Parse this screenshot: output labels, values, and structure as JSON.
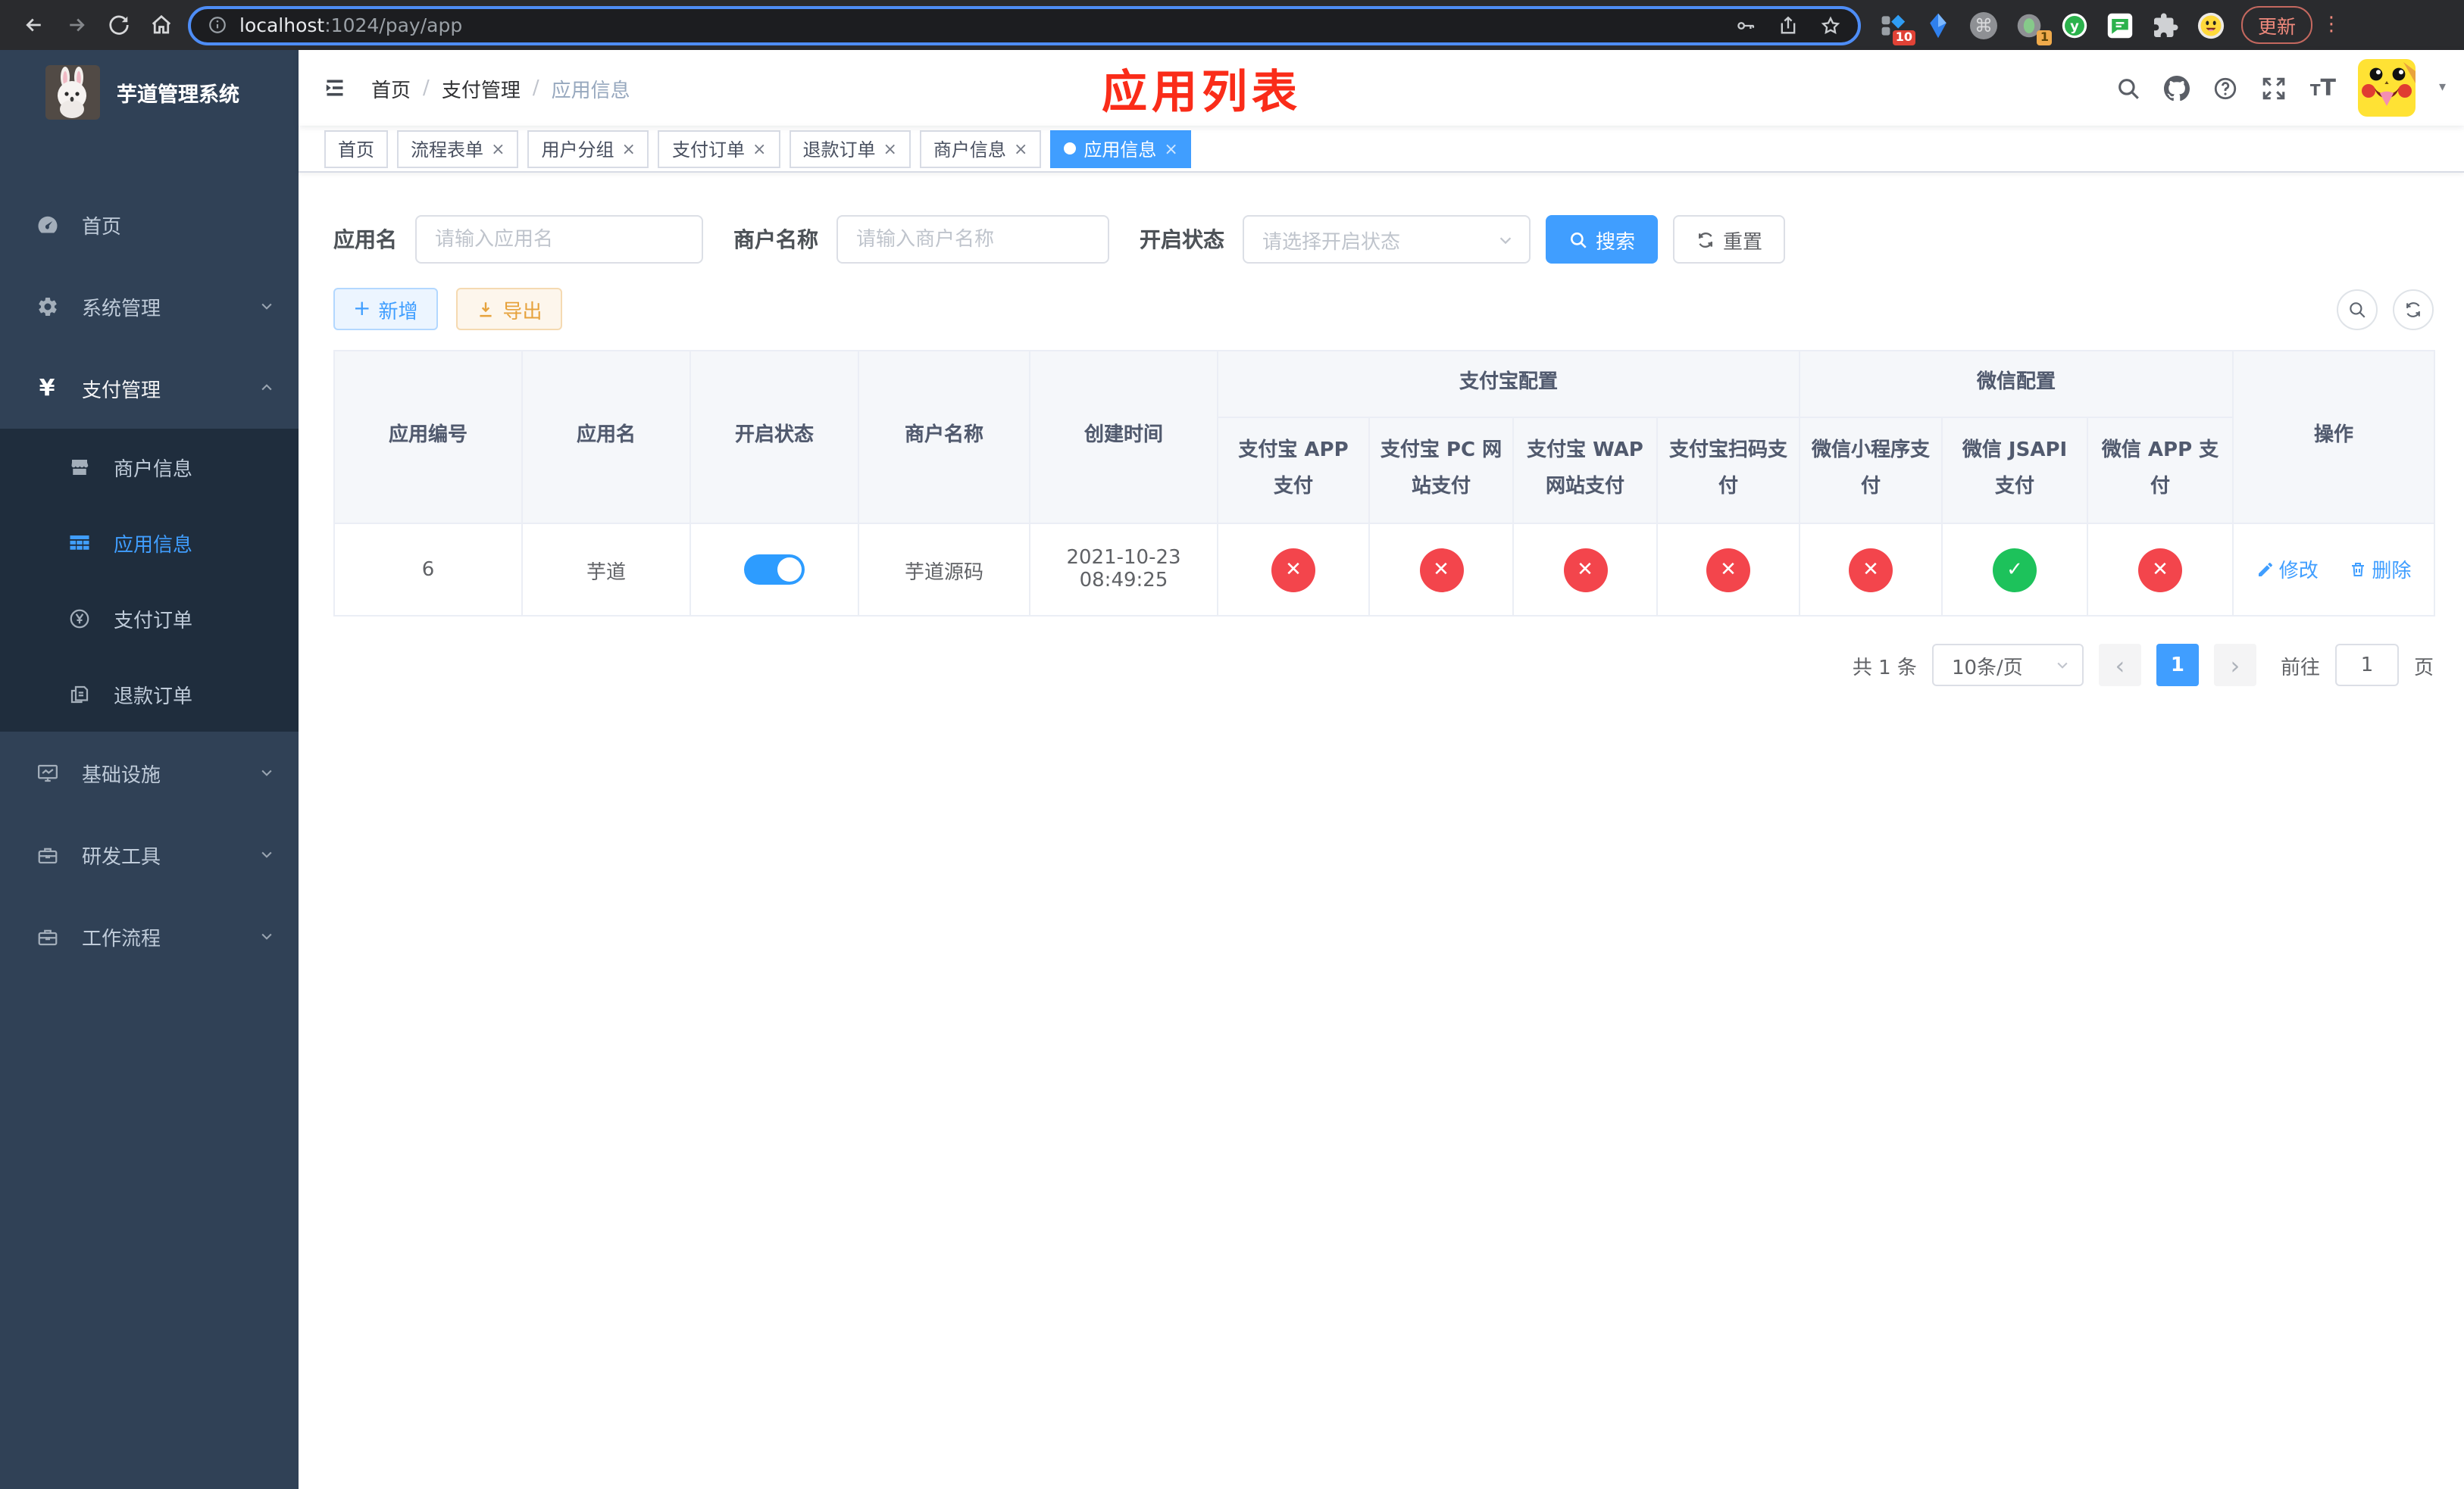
{
  "browser": {
    "url_host": "localhost",
    "url_path": ":1024/pay/app",
    "update_button": "更新",
    "extensions": {
      "badge_blue_diamond": "10",
      "badge_green_dot": "1"
    }
  },
  "sidebar": {
    "title": "芋道管理系统",
    "items": [
      {
        "label": "首页"
      },
      {
        "label": "系统管理"
      },
      {
        "label": "支付管理",
        "children": [
          {
            "label": "商户信息"
          },
          {
            "label": "应用信息"
          },
          {
            "label": "支付订单"
          },
          {
            "label": "退款订单"
          }
        ]
      },
      {
        "label": "基础设施"
      },
      {
        "label": "研发工具"
      },
      {
        "label": "工作流程"
      }
    ]
  },
  "navbar": {
    "breadcrumb": [
      "首页",
      "支付管理",
      "应用信息"
    ],
    "annotation": "应用列表"
  },
  "tabs": [
    {
      "label": "首页"
    },
    {
      "label": "流程表单"
    },
    {
      "label": "用户分组"
    },
    {
      "label": "支付订单"
    },
    {
      "label": "退款订单"
    },
    {
      "label": "商户信息"
    },
    {
      "label": "应用信息"
    }
  ],
  "filters": {
    "app_name_label": "应用名",
    "app_name_placeholder": "请输入应用名",
    "merchant_label": "商户名称",
    "merchant_placeholder": "请输入商户名称",
    "status_label": "开启状态",
    "status_placeholder": "请选择开启状态",
    "search_button": "搜索",
    "reset_button": "重置"
  },
  "toolbar": {
    "add_button": "新增",
    "export_button": "导出"
  },
  "table": {
    "main_columns": [
      "应用编号",
      "应用名",
      "开启状态",
      "商户名称",
      "创建时间"
    ],
    "group_alipay": {
      "label": "支付宝配置",
      "columns": [
        "支付宝 APP 支付",
        "支付宝 PC 网站支付",
        "支付宝 WAP 网站支付",
        "支付宝扫码支付"
      ]
    },
    "group_wechat": {
      "label": "微信配置",
      "columns": [
        "微信小程序支付",
        "微信 JSAPI 支付",
        "微信 APP 支付"
      ]
    },
    "actions_column": "操作",
    "rows": [
      {
        "app_id": "6",
        "app_name": "芋道",
        "enabled": "on",
        "merchant_name": "芋道源码",
        "create_time": "2021-10-23 08:49:25",
        "statuses": [
          "cross",
          "cross",
          "cross",
          "cross",
          "cross",
          "check",
          "cross"
        ],
        "edit_label": "修改",
        "delete_label": "删除"
      }
    ]
  },
  "pagination": {
    "total_text": "共 1 条",
    "page_size": "10条/页",
    "current_page": "1",
    "goto_label": "前往",
    "goto_value": "1",
    "page_unit": "页"
  },
  "colors": {
    "primary": "#409eff",
    "success": "#1dc25b",
    "danger": "#f3454c",
    "warning": "#e6a23c",
    "annotation_red": "#fa2c19",
    "sidebar_bg": "#304156",
    "submenu_bg": "#1f2d3d"
  }
}
